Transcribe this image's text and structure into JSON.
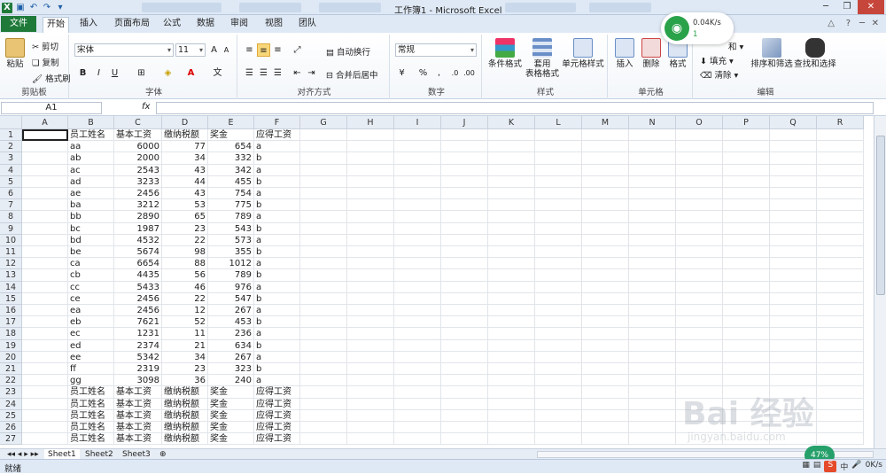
{
  "window": {
    "title": "工作簿1 - Microsoft Excel"
  },
  "network": {
    "speed": "0.04K/s",
    "count": "1"
  },
  "tabs": {
    "file": "文件",
    "items": [
      "开始",
      "插入",
      "页面布局",
      "公式",
      "数据",
      "审阅",
      "视图",
      "团队"
    ]
  },
  "ribbon": {
    "clipboard": {
      "label": "剪贴板",
      "paste": "粘贴",
      "cut": "剪切",
      "copy": "复制",
      "format_painter": "格式刷"
    },
    "font": {
      "label": "字体",
      "name": "宋体",
      "size": "11",
      "bold": "B",
      "italic": "I",
      "underline": "U"
    },
    "alignment": {
      "label": "对齐方式",
      "wrap": "自动换行",
      "merge": "合并后居中"
    },
    "number": {
      "label": "数字",
      "format": "常规",
      "percent": "%",
      "comma": ","
    },
    "styles": {
      "label": "样式",
      "conditional": "条件格式",
      "table_line1": "套用",
      "table_line2": "表格格式",
      "cell_styles": "单元格样式"
    },
    "cells": {
      "label": "单元格",
      "insert": "插入",
      "delete": "删除",
      "format": "格式"
    },
    "editing": {
      "label": "编辑",
      "sum_suffix": "和",
      "fill": "填充",
      "clear": "清除",
      "sort": "排序和筛选",
      "find": "查找和选择"
    }
  },
  "formula_bar": {
    "name_box": "A1",
    "fx": "fx",
    "value": ""
  },
  "columns": [
    "A",
    "B",
    "C",
    "D",
    "E",
    "F",
    "G",
    "H",
    "I",
    "J",
    "K",
    "L",
    "M",
    "N",
    "O",
    "P",
    "Q",
    "R"
  ],
  "rows": [
    [
      "",
      "员工姓名",
      "基本工资",
      "缴纳税额",
      "奖金",
      "应得工资"
    ],
    [
      "",
      "aa",
      "6000",
      "77",
      "654",
      "a"
    ],
    [
      "",
      "ab",
      "2000",
      "34",
      "332",
      "b"
    ],
    [
      "",
      "ac",
      "2543",
      "43",
      "342",
      "a"
    ],
    [
      "",
      "ad",
      "3233",
      "44",
      "455",
      "b"
    ],
    [
      "",
      "ae",
      "2456",
      "43",
      "754",
      "a"
    ],
    [
      "",
      "ba",
      "3212",
      "53",
      "775",
      "b"
    ],
    [
      "",
      "bb",
      "2890",
      "65",
      "789",
      "a"
    ],
    [
      "",
      "bc",
      "1987",
      "23",
      "543",
      "b"
    ],
    [
      "",
      "bd",
      "4532",
      "22",
      "573",
      "a"
    ],
    [
      "",
      "be",
      "5674",
      "98",
      "355",
      "b"
    ],
    [
      "",
      "ca",
      "6654",
      "88",
      "1012",
      "a"
    ],
    [
      "",
      "cb",
      "4435",
      "56",
      "789",
      "b"
    ],
    [
      "",
      "cc",
      "5433",
      "46",
      "976",
      "a"
    ],
    [
      "",
      "ce",
      "2456",
      "22",
      "547",
      "b"
    ],
    [
      "",
      "ea",
      "2456",
      "12",
      "267",
      "a"
    ],
    [
      "",
      "eb",
      "7621",
      "52",
      "453",
      "b"
    ],
    [
      "",
      "ec",
      "1231",
      "11",
      "236",
      "a"
    ],
    [
      "",
      "ed",
      "2374",
      "21",
      "634",
      "b"
    ],
    [
      "",
      "ee",
      "5342",
      "34",
      "267",
      "a"
    ],
    [
      "",
      "ff",
      "2319",
      "23",
      "323",
      "b"
    ],
    [
      "",
      "gg",
      "3098",
      "36",
      "240",
      "a"
    ],
    [
      "",
      "员工姓名",
      "基本工资",
      "缴纳税额",
      "奖金",
      "应得工资"
    ],
    [
      "",
      "员工姓名",
      "基本工资",
      "缴纳税额",
      "奖金",
      "应得工资"
    ],
    [
      "",
      "员工姓名",
      "基本工资",
      "缴纳税额",
      "奖金",
      "应得工资"
    ],
    [
      "",
      "员工姓名",
      "基本工资",
      "缴纳税额",
      "奖金",
      "应得工资"
    ],
    [
      "",
      "员工姓名",
      "基本工资",
      "缴纳税额",
      "奖金",
      "应得工资"
    ]
  ],
  "sheets": [
    "Sheet1",
    "Sheet2",
    "Sheet3"
  ],
  "status": {
    "ready": "就绪",
    "zoom_badge": "47%",
    "tray_speed": "0K/s",
    "tray_ime": "中"
  },
  "watermark": {
    "brand": "Bai 经验",
    "url": "jingyan.baidu.com"
  }
}
